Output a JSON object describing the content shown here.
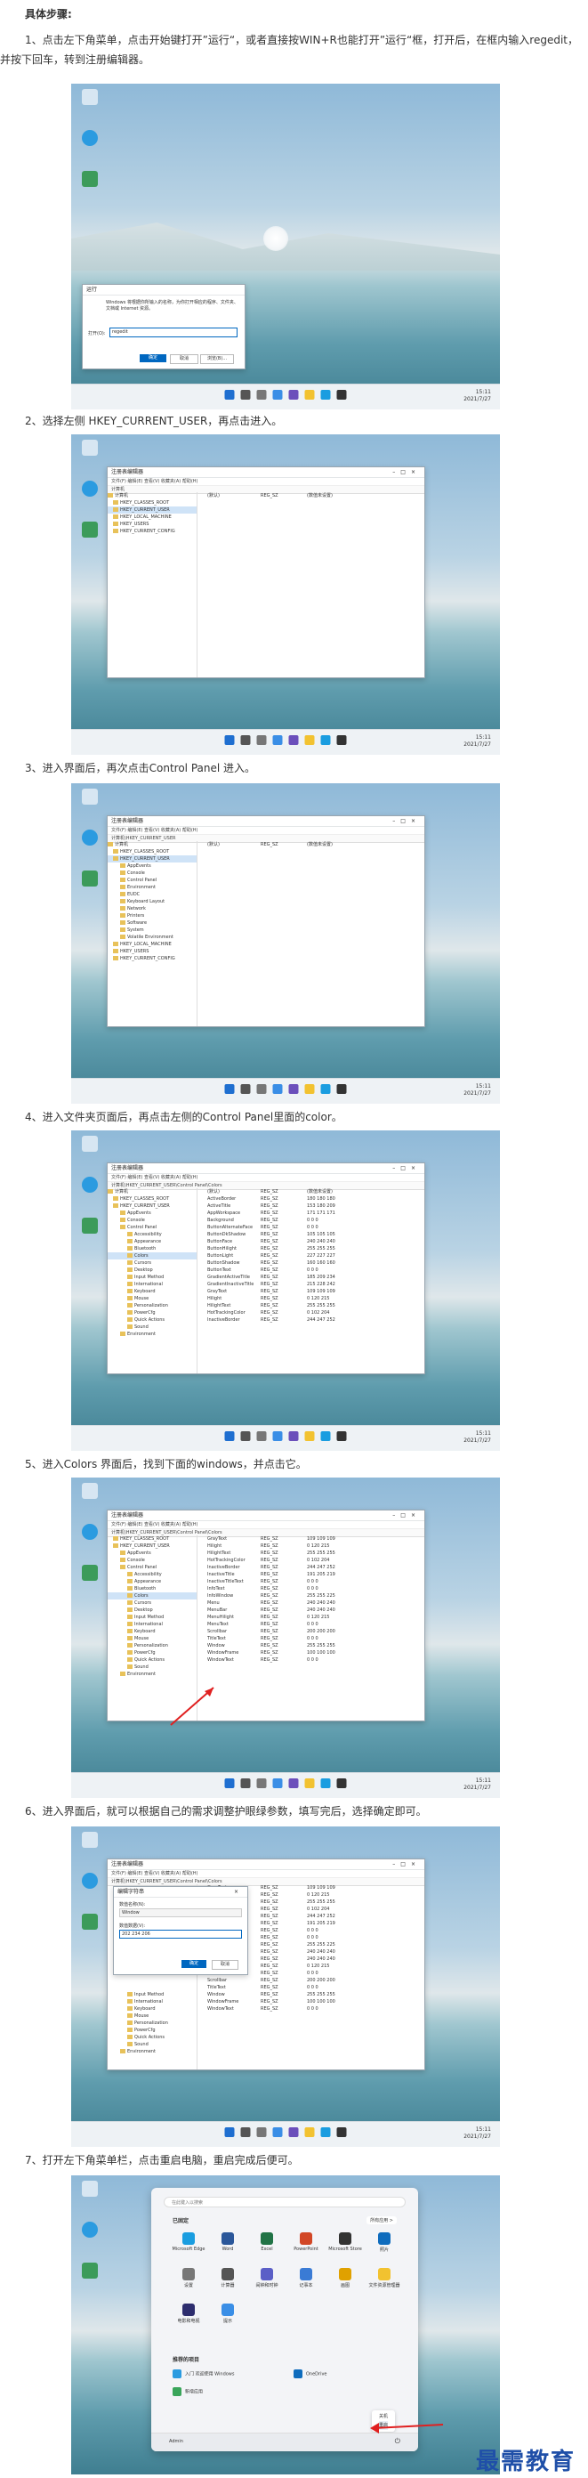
{
  "title": "具体步骤:",
  "steps": [
    "1、点击左下角菜单，点击开始键打开”运行“，或者直接按WIN+R也能打开”运行“框，打开后，在框内输入regedit，并按下回车，转到注册编辑器。",
    "2、选择左侧 HKEY_CURRENT_USER，再点击进入。",
    "3、进入界面后，再次点击Control Panel 进入。",
    "4、进入文件夹页面后，再点击左侧的Control Panel里面的color。",
    "5、进入Colors 界面后，找到下面的windows，并点击它。",
    "6、进入界面后，就可以根据自己的需求调整护眼绿参数，填写完后，选择确定即可。",
    "7、打开左下角菜单栏，点击重启电脑，重启完成后便可。"
  ],
  "run_dialog": {
    "title": "运行",
    "desc": "Windows 将根据你所输入的名称，为你打开相应的程序、文件夹、文档或 Internet 资源。",
    "open_label": "打开(O):",
    "value": "regedit",
    "ok": "确定",
    "cancel": "取消",
    "browse": "浏览(B)..."
  },
  "regedit": {
    "title": "注册表编辑器",
    "menu": "文件(F)  编辑(E)  查看(V)  收藏夹(A)  帮助(H)",
    "addr_root": "计算机",
    "addr_hkcu": "计算机\\HKEY_CURRENT_USER",
    "addr_colors": "计算机\\HKEY_CURRENT_USER\\Control Panel\\Colors",
    "root_nodes": [
      "计算机",
      "HKEY_CLASSES_ROOT",
      "HKEY_CURRENT_USER",
      "HKEY_LOCAL_MACHINE",
      "HKEY_USERS",
      "HKEY_CURRENT_CONFIG"
    ],
    "hkcu_children": [
      "AppEvents",
      "Console",
      "Control Panel",
      "Environment",
      "EUDC",
      "Keyboard Layout",
      "Network",
      "Printers",
      "Software",
      "System",
      "Volatile Environment"
    ],
    "cp_children": [
      "Accessibility",
      "Appearance",
      "Bluetooth",
      "Colors",
      "Cursors",
      "Desktop",
      "Input Method",
      "International",
      "Keyboard",
      "Mouse",
      "Personalization",
      "PowerCfg",
      "Quick Actions",
      "Sound"
    ],
    "default_row": [
      "(默认)",
      "REG_SZ",
      "(数值未设置)"
    ],
    "color_rows": [
      [
        "(默认)",
        "REG_SZ",
        "(数值未设置)"
      ],
      [
        "ActiveBorder",
        "REG_SZ",
        "180 180 180"
      ],
      [
        "ActiveTitle",
        "REG_SZ",
        "153 180 209"
      ],
      [
        "AppWorkspace",
        "REG_SZ",
        "171 171 171"
      ],
      [
        "Background",
        "REG_SZ",
        "0 0 0"
      ],
      [
        "ButtonAlternateFace",
        "REG_SZ",
        "0 0 0"
      ],
      [
        "ButtonDkShadow",
        "REG_SZ",
        "105 105 105"
      ],
      [
        "ButtonFace",
        "REG_SZ",
        "240 240 240"
      ],
      [
        "ButtonHilight",
        "REG_SZ",
        "255 255 255"
      ],
      [
        "ButtonLight",
        "REG_SZ",
        "227 227 227"
      ],
      [
        "ButtonShadow",
        "REG_SZ",
        "160 160 160"
      ],
      [
        "ButtonText",
        "REG_SZ",
        "0 0 0"
      ],
      [
        "GradientActiveTitle",
        "REG_SZ",
        "185 209 234"
      ],
      [
        "GradientInactiveTitle",
        "REG_SZ",
        "215 228 242"
      ],
      [
        "GrayText",
        "REG_SZ",
        "109 109 109"
      ],
      [
        "Hilight",
        "REG_SZ",
        "0 120 215"
      ],
      [
        "HilightText",
        "REG_SZ",
        "255 255 255"
      ],
      [
        "HotTrackingColor",
        "REG_SZ",
        "0 102 204"
      ],
      [
        "InactiveBorder",
        "REG_SZ",
        "244 247 252"
      ]
    ],
    "color_rows_lower": [
      [
        "GrayText",
        "REG_SZ",
        "109 109 109"
      ],
      [
        "Hilight",
        "REG_SZ",
        "0 120 215"
      ],
      [
        "HilightText",
        "REG_SZ",
        "255 255 255"
      ],
      [
        "HotTrackingColor",
        "REG_SZ",
        "0 102 204"
      ],
      [
        "InactiveBorder",
        "REG_SZ",
        "244 247 252"
      ],
      [
        "InactiveTitle",
        "REG_SZ",
        "191 205 219"
      ],
      [
        "InactiveTitleText",
        "REG_SZ",
        "0 0 0"
      ],
      [
        "InfoText",
        "REG_SZ",
        "0 0 0"
      ],
      [
        "InfoWindow",
        "REG_SZ",
        "255 255 225"
      ],
      [
        "Menu",
        "REG_SZ",
        "240 240 240"
      ],
      [
        "MenuBar",
        "REG_SZ",
        "240 240 240"
      ],
      [
        "MenuHilight",
        "REG_SZ",
        "0 120 215"
      ],
      [
        "MenuText",
        "REG_SZ",
        "0 0 0"
      ],
      [
        "Scrollbar",
        "REG_SZ",
        "200 200 200"
      ],
      [
        "TitleText",
        "REG_SZ",
        "0 0 0"
      ],
      [
        "Window",
        "REG_SZ",
        "255 255 255"
      ],
      [
        "WindowFrame",
        "REG_SZ",
        "100 100 100"
      ],
      [
        "WindowText",
        "REG_SZ",
        "0 0 0"
      ]
    ]
  },
  "edit_dialog": {
    "title": "编辑字符串",
    "name_label": "数值名称(N):",
    "name_value": "Window",
    "data_label": "数值数据(V):",
    "data_value": "202 234 206",
    "ok": "确定",
    "cancel": "取消"
  },
  "start_menu": {
    "search": "在此键入以搜索",
    "pinned_label": "已固定",
    "all_apps": "所有应用 >",
    "apps": [
      "Microsoft Edge",
      "Word",
      "Excel",
      "PowerPoint",
      "Microsoft Store",
      "照片",
      "设置",
      "计算器",
      "闹钟和时钟",
      "记事本",
      "画图",
      "文件资源管理器",
      "电影和电视",
      "提示"
    ],
    "recommended_label": "推荐的项目",
    "recommended": [
      "入门 欢迎使用 Windows",
      "OneDrive",
      "新增应用"
    ],
    "power_options": [
      "关机",
      "重启"
    ],
    "user": "Admin"
  },
  "taskbar_time": "15:11",
  "taskbar_date": "2021/7/27",
  "watermark": "最需教育"
}
